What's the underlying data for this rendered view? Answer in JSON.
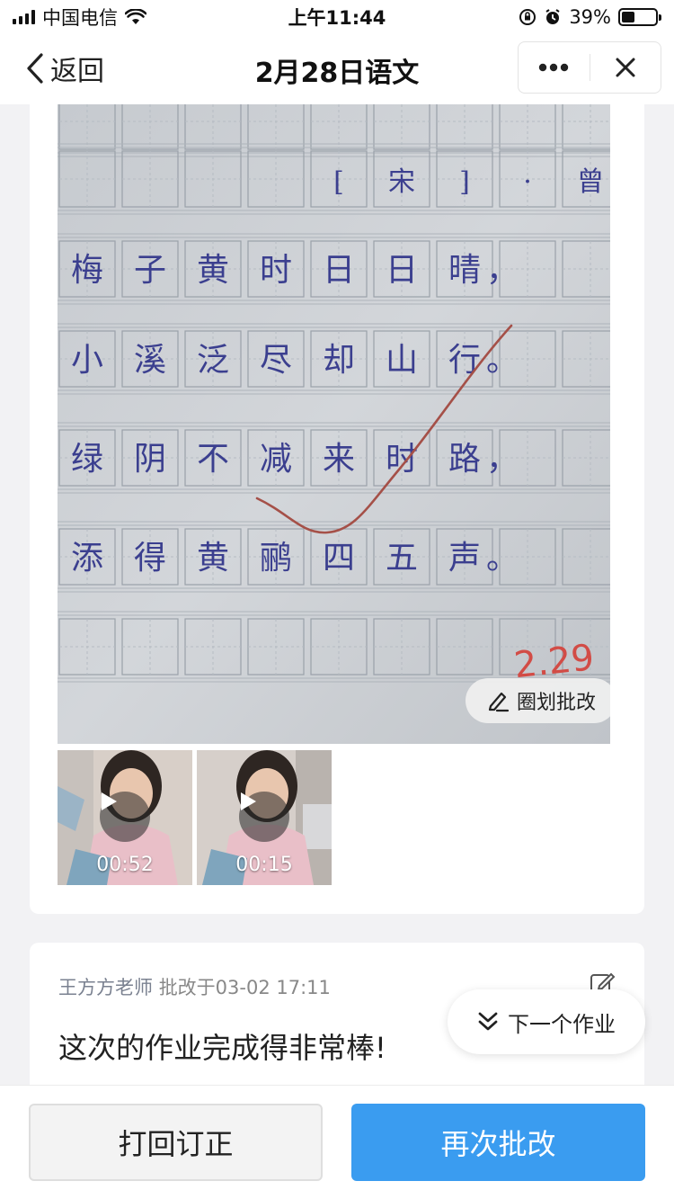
{
  "status_bar": {
    "carrier": "中国电信",
    "time": "上午11:44",
    "battery_text": "39%",
    "battery_level": 0.39
  },
  "nav": {
    "back_label": "返回",
    "title": "2月28日语文"
  },
  "homework": {
    "photo_icon": "handwritten-homework-photo",
    "poem_lines": [
      "[宋] · 曾几",
      "梅子黄时日日晴，",
      "小溪泛尽却山行。",
      "绿阴不减来时路，",
      "添得黄鹂四五声。"
    ],
    "date_mark": "2.29",
    "annotate_label": "圈划批改"
  },
  "videos": [
    {
      "duration": "00:52"
    },
    {
      "duration": "00:15"
    }
  ],
  "comment": {
    "teacher": "王方方老师",
    "meta_suffix": "批改于03-02 17:11",
    "text": "这次的作业完成得非常棒!"
  },
  "next_work_label": "下一个作业",
  "actions": {
    "return_label": "打回订正",
    "regrade_label": "再次批改"
  },
  "colors": {
    "primary": "#3a9cf0",
    "ink": "#3b3f8f",
    "check_mark": "#b0473a"
  }
}
